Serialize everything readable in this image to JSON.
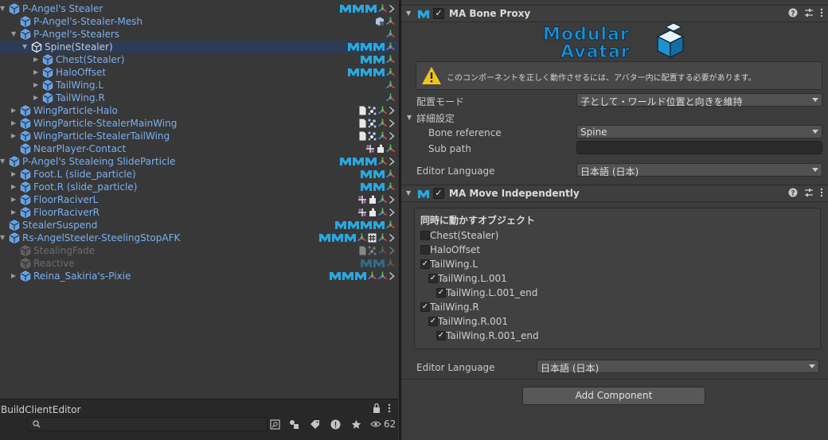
{
  "hierarchy": {
    "rows": [
      {
        "label": "P-Angel's Stealer",
        "depth": 0,
        "arrow": "open",
        "color": "blue",
        "icons": [
          "ma",
          "ma",
          "ma",
          "bone",
          "chev"
        ]
      },
      {
        "label": "P-Angel's-Stealer-Mesh",
        "depth": 1,
        "arrow": "none",
        "color": "blue",
        "icons": [
          "mesh",
          "bone"
        ]
      },
      {
        "label": "P-Angel's-Stealers",
        "depth": 1,
        "arrow": "open",
        "color": "blue",
        "icons": [
          "bone"
        ]
      },
      {
        "label": "Spine(Stealer)",
        "depth": 2,
        "arrow": "open",
        "color": "white",
        "selected": true,
        "icons": [
          "ma",
          "ma",
          "ma",
          "bone"
        ]
      },
      {
        "label": "Chest(Stealer)",
        "depth": 3,
        "arrow": "closed",
        "color": "blue",
        "icons": [
          "ma",
          "ma",
          "bone"
        ]
      },
      {
        "label": "HaloOffset",
        "depth": 3,
        "arrow": "closed",
        "color": "blue",
        "icons": [
          "ma",
          "ma",
          "ma",
          "bone"
        ]
      },
      {
        "label": "TailWing.L",
        "depth": 3,
        "arrow": "closed",
        "color": "blue",
        "icons": [
          "bone"
        ]
      },
      {
        "label": "TailWing.R",
        "depth": 3,
        "arrow": "closed",
        "color": "blue",
        "icons": [
          "bone"
        ]
      },
      {
        "label": "WingParticle-Halo",
        "depth": 1,
        "arrow": "closed",
        "color": "blue",
        "icons": [
          "doc",
          "particle",
          "bone",
          "chev"
        ]
      },
      {
        "label": "WingParticle-StealerMainWing",
        "depth": 1,
        "arrow": "closed",
        "color": "blue",
        "icons": [
          "doc",
          "particle",
          "bone",
          "chev"
        ]
      },
      {
        "label": "WingParticle-StealerTailWing",
        "depth": 1,
        "arrow": "closed",
        "color": "blue",
        "icons": [
          "doc",
          "particle",
          "bone",
          "chev"
        ]
      },
      {
        "label": "NearPlayer-Contact",
        "depth": 1,
        "arrow": "none",
        "color": "blue",
        "icons": [
          "contact",
          "puzzle",
          "bone"
        ]
      },
      {
        "label": "P-Angel's Stealeing SlideParticle",
        "depth": 0,
        "arrow": "open",
        "color": "blue",
        "icons": [
          "ma",
          "ma",
          "ma",
          "bone",
          "chev"
        ]
      },
      {
        "label": "Foot.L (slide_particle)",
        "depth": 1,
        "arrow": "closed",
        "color": "blue",
        "icons": [
          "ma",
          "ma",
          "bone"
        ]
      },
      {
        "label": "Foot.R (slide_particle)",
        "depth": 1,
        "arrow": "closed",
        "color": "blue",
        "icons": [
          "ma",
          "ma",
          "bone"
        ]
      },
      {
        "label": "FloorRaciverL",
        "depth": 1,
        "arrow": "closed",
        "color": "blue",
        "icons": [
          "contact",
          "puzzle",
          "bone",
          "chev"
        ]
      },
      {
        "label": "FloorRaciverR",
        "depth": 1,
        "arrow": "closed",
        "color": "blue",
        "icons": [
          "contact",
          "puzzle",
          "bone",
          "chev"
        ]
      },
      {
        "label": "StealerSuspend",
        "depth": 0,
        "arrow": "none",
        "color": "blue",
        "icons": [
          "ma",
          "ma",
          "ma",
          "ma",
          "bone"
        ]
      },
      {
        "label": "Rs-AngelSteeler-SteelingStopAFK",
        "depth": 0,
        "arrow": "open",
        "color": "blue",
        "icons": [
          "ma",
          "ma",
          "ma",
          "bone",
          "hash",
          "bone",
          "chev"
        ]
      },
      {
        "label": "StealingFade",
        "depth": 1,
        "arrow": "none",
        "color": "gray",
        "icons": [
          "doc",
          "particle",
          "bone",
          "chev"
        ]
      },
      {
        "label": "Reactive",
        "depth": 1,
        "arrow": "none",
        "color": "gray",
        "icons": [
          "ma",
          "ma",
          "bone"
        ]
      },
      {
        "label": "Reina_Sakiria's-Pixie",
        "depth": 1,
        "arrow": "closed",
        "color": "blue",
        "icons": [
          "ma",
          "ma",
          "ma",
          "bone",
          "bone",
          "chev"
        ]
      }
    ]
  },
  "bottom_panel": {
    "title": "BuildClientEditor",
    "search_placeholder": "",
    "hidden_count": "62"
  },
  "inspector": {
    "bone_proxy": {
      "title": "MA Bone Proxy",
      "logo_line1": "Modular",
      "logo_line2": "Avatar",
      "warning": "このコンポーネントを正しく動作させるには、アバター内に配置する必要があります。",
      "placement_label": "配置モード",
      "placement_value": "子として・ワールド位置と向きを維持",
      "advanced_label": "詳細設定",
      "bone_ref_label": "Bone reference",
      "bone_ref_value": "Spine",
      "sub_path_label": "Sub path",
      "sub_path_value": "",
      "editor_lang_label": "Editor Language",
      "editor_lang_value": "日本語 (日本)"
    },
    "move_independently": {
      "title": "MA Move Independently",
      "group_title": "同時に動かすオブジェクト",
      "items": [
        {
          "label": "Chest(Stealer)",
          "checked": false,
          "indent": 0
        },
        {
          "label": "HaloOffset",
          "checked": false,
          "indent": 0
        },
        {
          "label": "TailWing.L",
          "checked": true,
          "indent": 0
        },
        {
          "label": "TailWing.L.001",
          "checked": true,
          "indent": 1
        },
        {
          "label": "TailWing.L.001_end",
          "checked": true,
          "indent": 2
        },
        {
          "label": "TailWing.R",
          "checked": true,
          "indent": 0
        },
        {
          "label": "TailWing.R.001",
          "checked": true,
          "indent": 1
        },
        {
          "label": "TailWing.R.001_end",
          "checked": true,
          "indent": 2
        }
      ],
      "editor_lang_label": "Editor Language",
      "editor_lang_value": "日本語 (日本)"
    },
    "add_component": "Add Component"
  },
  "colors": {
    "accent_blue": "#7ab0f2",
    "ma_cyan": "#29a8e0",
    "selection": "#2c3c56",
    "warning_yellow": "#f0c419"
  }
}
